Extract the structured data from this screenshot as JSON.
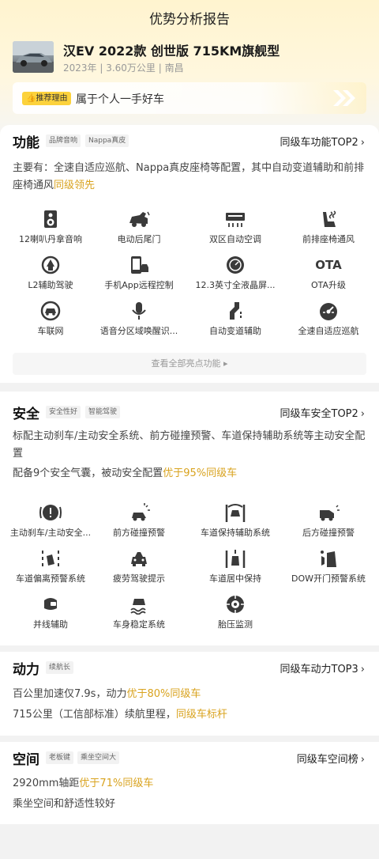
{
  "title": "优势分析报告",
  "car": {
    "name": "汉EV 2022款 创世版 715KM旗舰型",
    "meta": "2023年 | 3.60万公里 | 南昌"
  },
  "reason": {
    "badge": "推荐理由",
    "text": "属于个人一手好车"
  },
  "function": {
    "title": "功能",
    "tags": [
      "品牌音响",
      "Nappa真皮"
    ],
    "rank": "同级车功能TOP2",
    "desc_prefix": "主要有：全速自适应巡航、Nappa真皮座椅等配置，其中自动变道辅助和前排座椅通风",
    "desc_highlight": "同级领先",
    "features": [
      "12喇叭丹拿音响",
      "电动后尾门",
      "双区自动空调",
      "前排座椅通风",
      "L2辅助驾驶",
      "手机App远程控制",
      "12.3英寸全液晶屏...",
      "OTA升级",
      "车联网",
      "语音分区域唤醒识...",
      "自动变道辅助",
      "全速自适应巡航"
    ],
    "icons": [
      "speaker-icon",
      "tailgate-icon",
      "climate-control-icon",
      "seat-ventilation-icon",
      "driver-assist-icon",
      "phone-remote-icon",
      "lcd-screen-icon",
      "ota-icon",
      "connected-car-icon",
      "voice-mic-icon",
      "lane-change-icon",
      "adaptive-cruise-icon"
    ],
    "ota_text": "OTA",
    "view_all": "查看全部亮点功能"
  },
  "safety": {
    "title": "安全",
    "tags": [
      "安全性好",
      "智能驾驶"
    ],
    "rank": "同级车安全TOP2",
    "desc": "标配主动刹车/主动安全系统、前方碰撞预警、车道保持辅助系统等主动安全配置",
    "line2_prefix": "配备9个安全气囊，被动安全配置",
    "line2_highlight": "优于95%同级车",
    "features": [
      "主动刹车/主动安全...",
      "前方碰撞预警",
      "车道保持辅助系统",
      "后方碰撞预警",
      "车道偏离预警系统",
      "疲劳驾驶提示",
      "车道居中保持",
      "DOW开门预警系统",
      "并线辅助",
      "车身稳定系统",
      "胎压监测"
    ],
    "icons": [
      "brake-warning-icon",
      "front-collision-icon",
      "lane-keep-icon",
      "rear-collision-icon",
      "lane-departure-icon",
      "fatigue-icon",
      "lane-center-icon",
      "door-warning-icon",
      "blind-spot-icon",
      "stability-icon",
      "tire-pressure-icon"
    ]
  },
  "power": {
    "title": "动力",
    "tags": [
      "续航长"
    ],
    "rank": "同级车动力TOP3",
    "line1_prefix": "百公里加速仅7.9s，动力",
    "line1_highlight": "优于80%同级车",
    "line2_prefix": "715公里（工信部标准）续航里程，",
    "line2_highlight": "同级车标杆"
  },
  "space": {
    "title": "空间",
    "tags": [
      "老板键",
      "乘坐空间大"
    ],
    "rank": "同级车空间榜",
    "line1_prefix": "2920mm轴距",
    "line1_highlight": "优于71%同级车",
    "line2": "乘坐空间和舒适性较好"
  },
  "colors": {
    "accent": "#d9a31f",
    "badge": "#fcd23c",
    "icon": "#3a3a3a"
  }
}
